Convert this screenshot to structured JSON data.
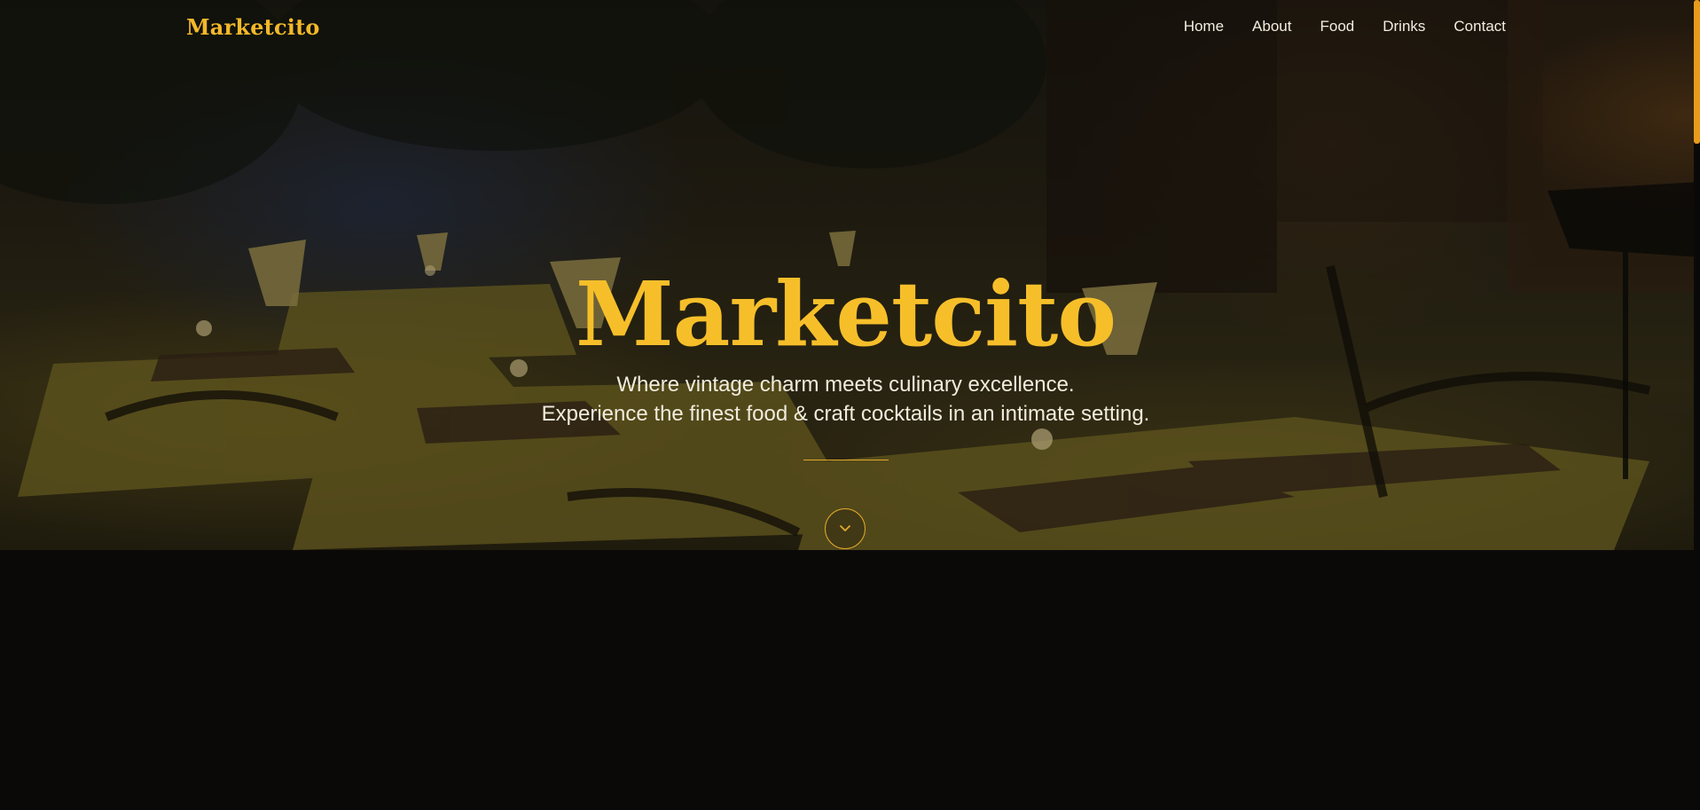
{
  "nav": {
    "brand": "Marketcito",
    "links": [
      "Home",
      "About",
      "Food",
      "Drinks",
      "Contact"
    ]
  },
  "hero": {
    "title": "Marketcito",
    "tagline_line1": "Where vintage charm meets culinary excellence.",
    "tagline_line2": "Experience the finest food & craft cocktails in an intimate setting.",
    "scroll_icon": "chevron-down-icon",
    "background": "restaurant-interior-photo"
  },
  "colors": {
    "accent": "#f6bf2a",
    "nav_text": "#f3ede0",
    "page_background": "#0b0908",
    "scrollbar_thumb": "#e89a1c"
  }
}
